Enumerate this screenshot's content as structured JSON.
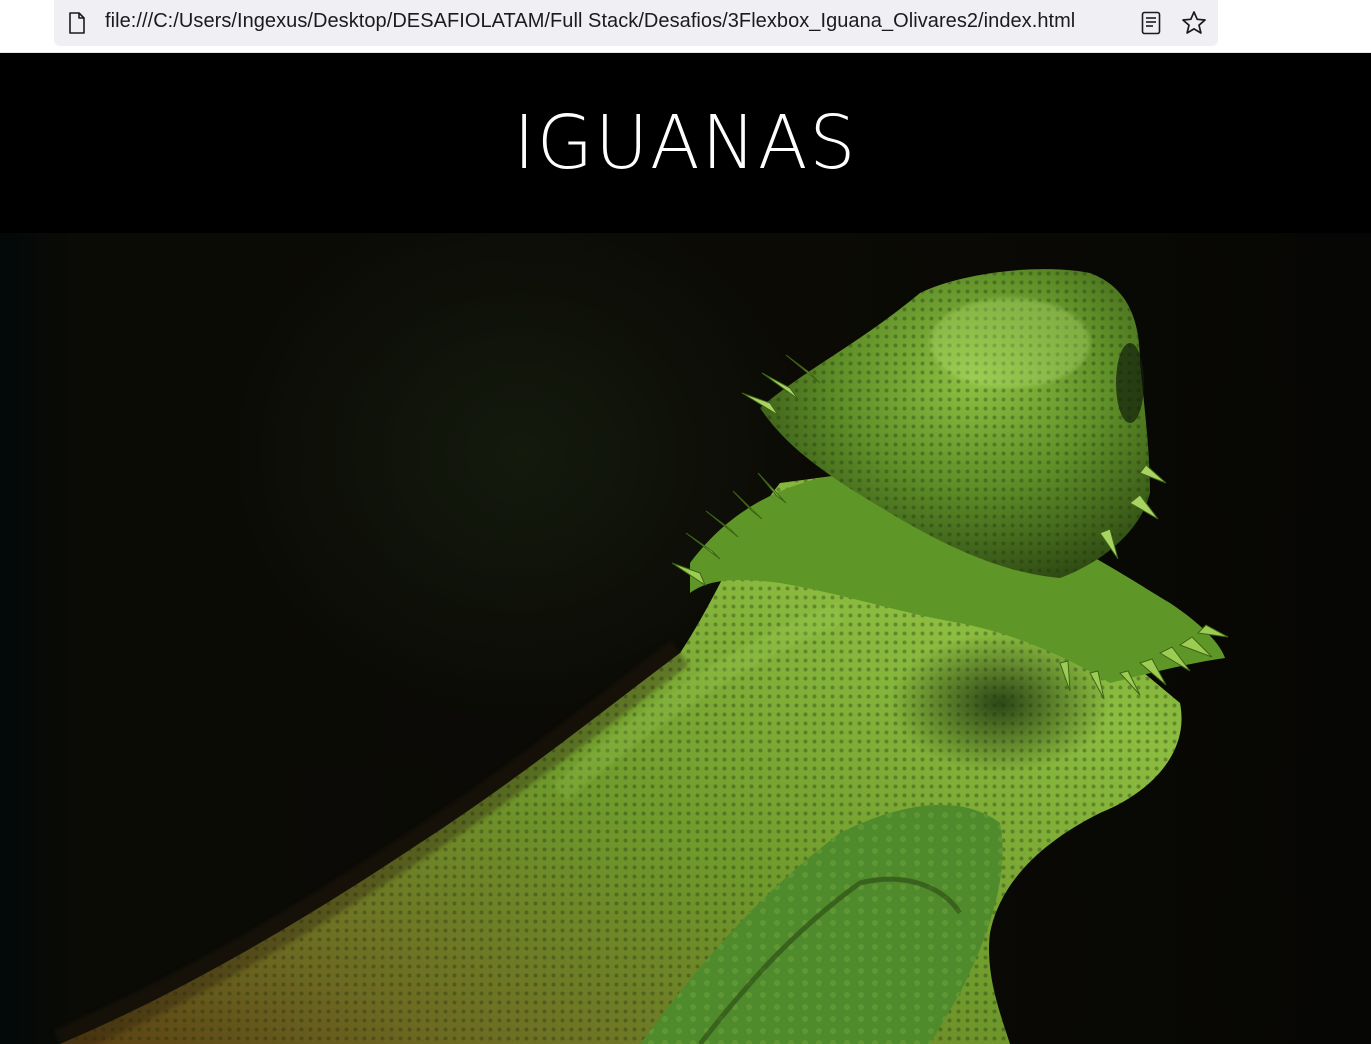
{
  "browser": {
    "url": "file:///C:/Users/Ingexus/Desktop/DESAFIOLATAM/Full Stack/Desafios/3Flexbox_Iguana_Olivares2/index.html",
    "page_icon": "document-icon",
    "reader_icon": "reader-view-icon",
    "bookmark_icon": "star-icon"
  },
  "header": {
    "title": "IGUANAS"
  },
  "hero": {
    "image": "iguana-photo"
  },
  "colors": {
    "header_bg": "#000000",
    "title": "#ffffff",
    "iguana_green": "#6a9a2e"
  }
}
